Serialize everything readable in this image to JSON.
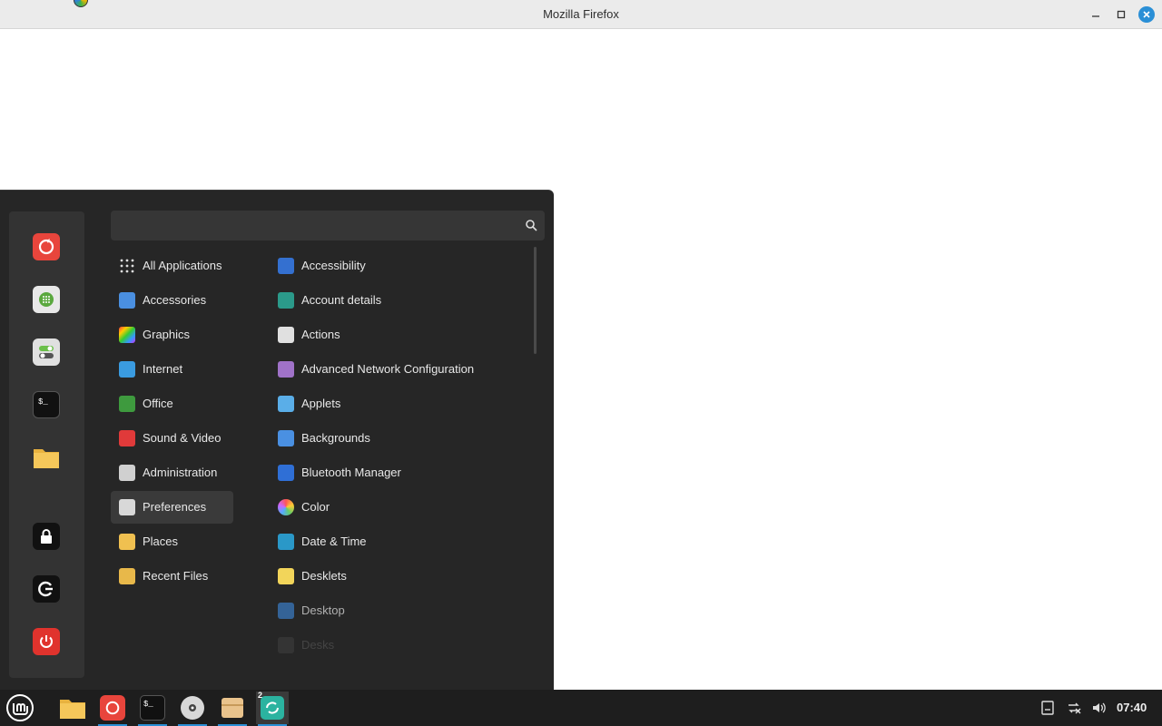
{
  "window": {
    "title": "Mozilla Firefox"
  },
  "menu": {
    "search": {
      "placeholder": "",
      "value": ""
    },
    "favorites": [
      {
        "name": "firefox",
        "icon": "firefox-icon"
      },
      {
        "name": "software-manager",
        "icon": "grid-icon"
      },
      {
        "name": "system-settings",
        "icon": "toggles-icon"
      },
      {
        "name": "terminal",
        "icon": "terminal-icon"
      },
      {
        "name": "files",
        "icon": "folder-icon"
      }
    ],
    "session": [
      {
        "name": "lock-screen",
        "icon": "lock-icon"
      },
      {
        "name": "logout",
        "icon": "logout-icon"
      },
      {
        "name": "quit",
        "icon": "power-icon"
      }
    ],
    "categories": [
      {
        "label": "All Applications"
      },
      {
        "label": "Accessories"
      },
      {
        "label": "Graphics"
      },
      {
        "label": "Internet"
      },
      {
        "label": "Office"
      },
      {
        "label": "Sound & Video"
      },
      {
        "label": "Administration"
      },
      {
        "label": "Preferences",
        "selected": true
      },
      {
        "label": "Places"
      },
      {
        "label": "Recent Files"
      }
    ],
    "apps": [
      {
        "label": "Accessibility"
      },
      {
        "label": "Account details"
      },
      {
        "label": "Actions"
      },
      {
        "label": "Advanced Network Configuration"
      },
      {
        "label": "Applets"
      },
      {
        "label": "Backgrounds"
      },
      {
        "label": "Bluetooth Manager"
      },
      {
        "label": "Color"
      },
      {
        "label": "Date & Time"
      },
      {
        "label": "Desklets"
      },
      {
        "label": "Desktop"
      },
      {
        "label": "Desks"
      }
    ]
  },
  "taskbar": {
    "clock": "07:40",
    "badge": "2"
  },
  "colors": {
    "accent": "#2a8fd6",
    "menu_bg": "#262626",
    "panel_bg": "#1e1e1e"
  }
}
